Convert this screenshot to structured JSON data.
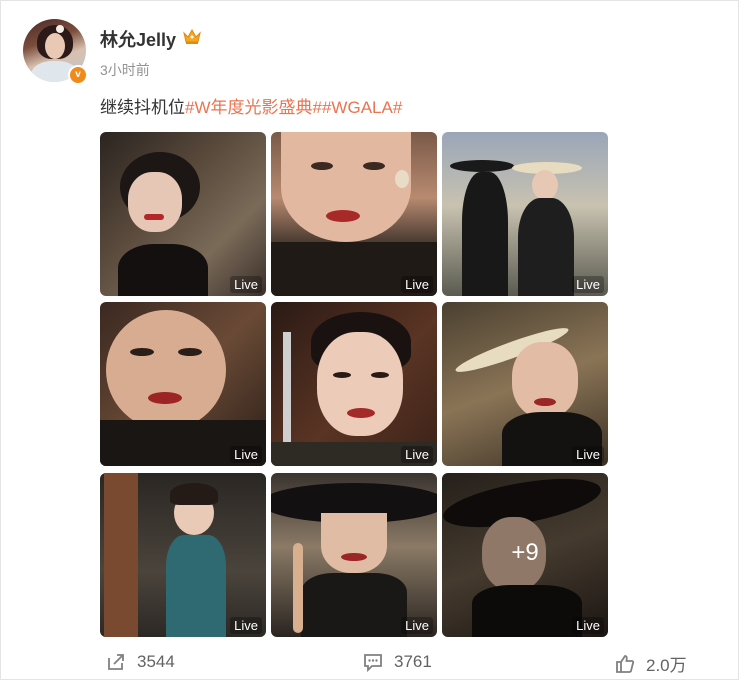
{
  "post": {
    "author": "林允Jelly",
    "time": "3小时前",
    "text_plain": "继续抖机位",
    "hashtags": [
      "#W年度光影盛典#",
      "#WGALA#"
    ],
    "verified_badge_text": "v"
  },
  "images": {
    "live_label": "Live",
    "more_count": "+9",
    "items": [
      {
        "label": "Live"
      },
      {
        "label": "Live"
      },
      {
        "label": "Live"
      },
      {
        "label": "Live"
      },
      {
        "label": "Live"
      },
      {
        "label": "Live"
      },
      {
        "label": "Live"
      },
      {
        "label": "Live"
      },
      {
        "label": "Live"
      }
    ]
  },
  "actions": {
    "repost_count": "3544",
    "comment_count": "3761",
    "like_count": "2.0万"
  },
  "colors": {
    "hashtag": "#eb7350",
    "username": "#333333",
    "timestamp": "#939393",
    "crown": "#f5a623"
  }
}
